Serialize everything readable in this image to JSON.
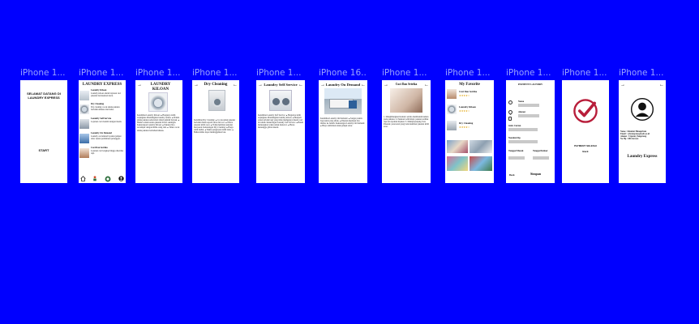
{
  "frames": [
    {
      "label": "iPhone 1...",
      "welcome": "SELAMAT DATANG DI LAUNDRY EXPRESS",
      "start": "START"
    },
    {
      "label": "iPhone 1...",
      "title": "LAUNDRY EXPRESS",
      "items": [
        {
          "name": "Laundry Kiloan",
          "desc": "Laundry kiloan adalah layanan cuci pakaian berdasarkan berat."
        },
        {
          "name": "Dry Cleaning",
          "desc": "Dry cleaning cocok untuk pakaian berbahan khusus dan halus."
        },
        {
          "name": "Laundry Self Service",
          "desc": "Layanan cuci mandiri dengan mesin."
        },
        {
          "name": "Laundry On Demand",
          "desc": "Laundry on demand layanan jemput antar sesuai permintaan pelanggan."
        },
        {
          "name": "Cuci Dan Setrika",
          "desc": "Layanan cuci lengkap hingga disetrika rapi."
        }
      ],
      "nav": [
        "home-icon",
        "delivery-icon",
        "laundry-icon",
        "profile-icon"
      ]
    },
    {
      "label": "iPhone 1...",
      "title": "LAUNDRY KILOAN",
      "body": "Kelebihan Laundry Kiloan: ● Harganya lebih terjangkau dibandingkan laundry satuan. ● Praktis untuk pakaian sehari-hari dalam jumlah banyak. ● Hemat waktu karena pakaian dicuci sekaligus. Kekurangan Laundry Kiloan: ● Pakaian bisa tercampur dengan milik orang lain. ● Tidak cocok untuk pakaian berbahan khusus."
    },
    {
      "label": "iPhone 1...",
      "title": "Dry Cleaning",
      "body": "Kelebihan Dry Cleaning: ● Cocok untuk pakaian berbahan halus seperti sutra dan wol. ● Warna pakaian lebih awet. ● Tidak membuat pakaian menyusut. Kekurangan Dry Cleaning: ● Harga lebih mahal. ● Waktu pengerjaan lebih lama. ● Bahan kimia dapat meninggalkan bau."
    },
    {
      "label": "iPhone 1...",
      "title": "Laundry Self Service",
      "body": "Kelebihan Laundry Self Service: ● Harganya lebih terjangkau dibandingkan laundry kiloan. ● Menjadi solusi terbaik bagi yang tidak mempunyai mesin cuci di rumah. Kekurangan Laundry Self Service: ● Butuh meluangkan waktu untuk mencuci. ● Harus menunggu giliran mesin."
    },
    {
      "label": "iPhone 16...",
      "title": "Laundry On Demand",
      "body": "Kelebihan Laundry On Demand: ● Sangat praktis bagi Anda yang sibuk. ● Pakaian dijemput dan diantar ke rumah. Kekurangan Laundry On Demand: ● Biaya tambahan untuk jemput antar."
    },
    {
      "label": "iPhone 1...",
      "title": "Cuci Dan Setrika",
      "body": "1. Menghilangkan Kuman: setrika membunuh kuman pada pakaian. 2. Pakaian Lebih Rapi: pakaian terlihat rapi dan nyaman dipakai. 3. Memperpanjang Usia Pakaian: perawatan yang baik membuat pakaian lebih awet."
    },
    {
      "label": "iPhone 1...",
      "title": "My Favorite",
      "favorites": [
        {
          "name": "Cuci Dan Setrika",
          "stars": "★★★★☆"
        },
        {
          "name": "Laundry Kiloan",
          "stars": "★★★★☆"
        },
        {
          "name": "Dry Cleaning",
          "stars": "★★★★☆"
        }
      ]
    },
    {
      "label": "iPhone 1...",
      "title": "PAYMENT LAUNDRY",
      "fields": [
        "Nama",
        "Alamat",
        "Jenis Cucian",
        "Nominal Rp.",
        "Tanggal Masuk",
        "Tanggal Keluar"
      ],
      "back": "Back",
      "save": "Simpan"
    },
    {
      "label": "iPhone 1...",
      "message": "PAYMENT SELESAI",
      "next": "Back"
    },
    {
      "label": "iPhone 1...",
      "profile_lines": [
        "Name : Khaidar Himaprinsk",
        "Email : cyberexpress@web.ac.id",
        "Alamat : Ciputat, Tangerang",
        "No Hp : 0812xxxxxx"
      ],
      "brand": "Laundry Express"
    }
  ],
  "colors": {
    "background": "#0000ff",
    "label": "#9aa3ff",
    "check": "#b81d3a",
    "bar": "#c9c9c9"
  }
}
